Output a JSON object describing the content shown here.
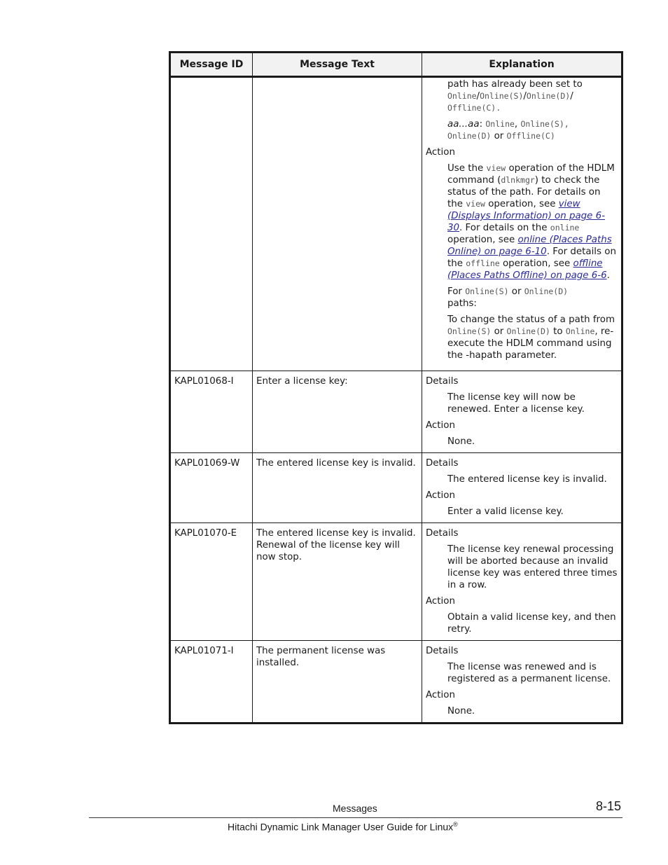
{
  "table": {
    "headers": [
      "Message ID",
      "Message Text",
      "Explanation"
    ],
    "continued_row": {
      "p1_text": "path has already been set to",
      "p1_codes": [
        "Online",
        "Online(S)",
        "Online(D)",
        "Offline(C)"
      ],
      "p2_var": "aa...aa",
      "p2_codes": [
        "Online",
        "Online(S)",
        "Online(D)",
        "Offline(C)"
      ],
      "p2_or": "or",
      "action_label": "Action",
      "action": {
        "t1": "Use the",
        "c_view": "view",
        "t2": "operation of the HDLM command (",
        "c_dlnkmgr": "dlnkmgr",
        "t3": ") to check the status of the path. For details on the",
        "t4": "operation, see",
        "link1": "view (Displays Information) on page 6-30",
        "t5": ". For details on the",
        "c_online": "online",
        "t6": "operation, see",
        "link2": "online (Places Paths Online) on page 6-10",
        "t7": ". For details on the",
        "c_offline": "offline",
        "t8": "operation, see",
        "link3": "offline (Places Paths Offline) on page 6-6",
        "t9": "."
      },
      "for_text1": "For",
      "for_or": "or",
      "for_text2": "paths:",
      "change": {
        "t1": "To change the status of a path from",
        "or": "or",
        "to": "to",
        "c_online": "Online",
        "t2": ", re-execute the HDLM command using the -hapath parameter."
      },
      "codes_s": "Online(S)",
      "codes_d": "Online(D)"
    },
    "rows": [
      {
        "id": "KAPL01068-I",
        "text": "Enter a license key:",
        "details_label": "Details",
        "details": "The license key will now be renewed. Enter a license key.",
        "action_label": "Action",
        "action": "None."
      },
      {
        "id": "KAPL01069-W",
        "text": "The entered license key is invalid.",
        "details_label": "Details",
        "details": "The entered license key is invalid.",
        "action_label": "Action",
        "action": "Enter a valid license key."
      },
      {
        "id": "KAPL01070-E",
        "text": "The entered license key is invalid. Renewal of the license key will now stop.",
        "details_label": "Details",
        "details": "The license key renewal processing will be aborted because an invalid license key was entered three times in a row.",
        "action_label": "Action",
        "action": "Obtain a valid license key, and then retry."
      },
      {
        "id": "KAPL01071-I",
        "text": "The permanent license was installed.",
        "details_label": "Details",
        "details": "The license was renewed and is registered as a permanent license.",
        "action_label": "Action",
        "action": "None."
      }
    ]
  },
  "footer": {
    "section": "Messages",
    "page": "8-15",
    "book": "Hitachi Dynamic Link Manager User Guide for Linux",
    "reg": "®"
  },
  "colors": {
    "link": "#2a2a9a",
    "header_bg": "#f2f2f2",
    "border": "#1a1a1a"
  }
}
